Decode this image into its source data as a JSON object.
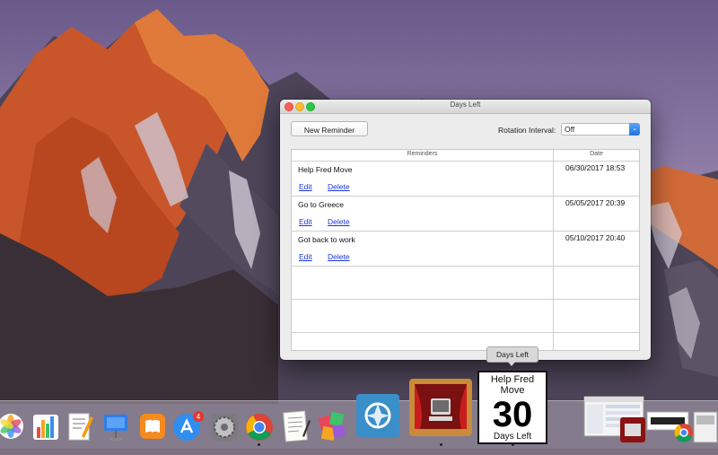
{
  "window": {
    "title": "Days Left"
  },
  "toolbar": {
    "new_reminder_label": "New Reminder",
    "rotation_label": "Rotation Interval:",
    "rotation_value": "Off"
  },
  "table": {
    "headers": [
      "Reminders",
      "Date"
    ],
    "rows": [
      {
        "title": "Help Fred Move",
        "date": "06/30/2017 18:53",
        "edit": "Edit",
        "delete": "Delete"
      },
      {
        "title": "Go to Greece",
        "date": "05/05/2017 20:39",
        "edit": "Edit",
        "delete": "Delete"
      },
      {
        "title": "Got back to work",
        "date": "05/10/2017 20:40",
        "edit": "Edit",
        "delete": "Delete"
      }
    ]
  },
  "tooltip": {
    "text": "Days Left"
  },
  "dock_widget": {
    "reminder": "Help Fred Move",
    "days": "30",
    "caption": "Days Left"
  },
  "badges": {
    "app_store": "4"
  },
  "colors": {
    "link": "#1a36d9",
    "popup_accent": "#1f73e0",
    "close": "#fc5f57",
    "minimize": "#fdbc2e",
    "maximize": "#28c940"
  },
  "dock_icons": [
    "photos-icon",
    "numbers-icon",
    "pages-icon",
    "keynote-icon",
    "ibooks-icon",
    "app-store-icon",
    "system-preferences-icon",
    "chrome-icon",
    "textedit-icon",
    "photo-collage-icon",
    "photo-editor-icon",
    "theater-app-icon",
    "days-left-icon",
    "finder-window-thumbnail-icon",
    "dvd-player-icon",
    "chrome-thumbnail-icon"
  ]
}
